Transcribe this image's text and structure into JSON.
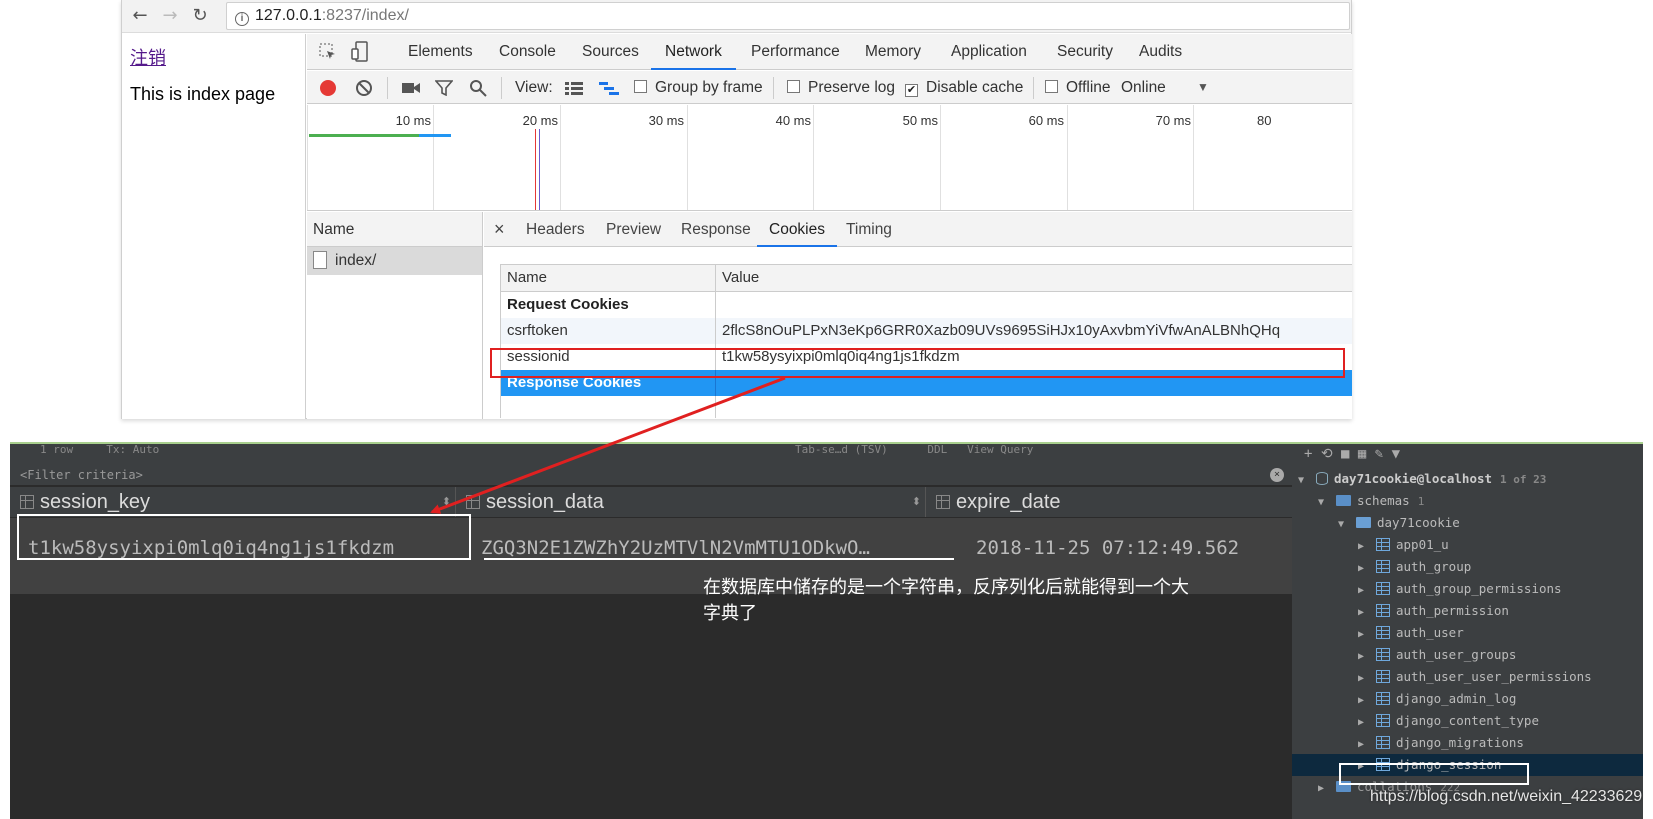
{
  "browser": {
    "url_host": "127.0.0.1",
    "url_rest": ":8237/index/",
    "back_glyph": "←",
    "forward_glyph": "→",
    "reload_glyph": "↻",
    "info_glyph": "i"
  },
  "page": {
    "logout_link": "注销",
    "index_text": "This is index page"
  },
  "devtools": {
    "tabs": [
      "Elements",
      "Console",
      "Sources",
      "Network",
      "Performance",
      "Memory",
      "Application",
      "Security",
      "Audits"
    ],
    "active_tab": "Network",
    "toolbar": {
      "view_label": "View:",
      "group_by_frame": "Group by frame",
      "preserve_log": "Preserve log",
      "disable_cache": "Disable cache",
      "disable_cache_checked": "✔",
      "offline": "Offline",
      "throttle": "Online",
      "throttle_caret": "▼"
    },
    "timeline_ticks": [
      "10 ms",
      "20 ms",
      "30 ms",
      "40 ms",
      "50 ms",
      "60 ms",
      "70 ms",
      "80"
    ],
    "name_header": "Name",
    "request_name": "index/",
    "close_glyph": "×",
    "detail_tabs": [
      "Headers",
      "Preview",
      "Response",
      "Cookies",
      "Timing"
    ],
    "active_detail_tab": "Cookies",
    "cookie_table": {
      "col_name": "Name",
      "col_value": "Value",
      "request_group": "Request Cookies",
      "rows": [
        {
          "name": "csrftoken",
          "value": "2flcS8nOuPLPxN3eKp6GRR0Xazb09UVs9695SiHJx10yAxvbmYiVfwAnALBNhQHq"
        },
        {
          "name": "sessionid",
          "value": "t1kw58ysyixpi0mlq0iq4ng1js1fkdzm"
        }
      ],
      "response_group": "Response Cookies"
    }
  },
  "ide": {
    "toolbar_text": "1 row     Tx: Auto                                                                                                Tab-se…d (TSV)      DDL   View Query",
    "filter_placeholder": "<Filter criteria>",
    "clear_glyph": "×",
    "sort_glyph": "⬍",
    "columns": [
      "session_key",
      "session_data",
      "expire_date"
    ],
    "row": {
      "session_key": "t1kw58ysyixpi0mlq0iq4ng1js1fkdzm",
      "session_data": "ZGQ3N2E1ZWZhY2UzMTVlN2VmMTU1ODkwO…",
      "expire_date": "2018-11-25 07:12:49.562"
    },
    "annotation": "在数据库中储存的是一个字符串，反序列化后就能得到一个大字典了"
  },
  "db_tree": {
    "toolbar": "+  ⟲  ■  ▦  ✎  ▼",
    "arrow_expanded": "▼",
    "arrow_collapsed": "▶",
    "connection": "day71cookie@localhost",
    "connection_count": "1 of 23",
    "schemas": "schemas",
    "schemas_count": "1",
    "database": "day71cookie",
    "tables": [
      "app01_u",
      "auth_group",
      "auth_group_permissions",
      "auth_permission",
      "auth_user",
      "auth_user_groups",
      "auth_user_user_permissions",
      "django_admin_log",
      "django_content_type",
      "django_migrations",
      "django_session"
    ],
    "collations": "collations",
    "collations_count": "222",
    "selected_table": "django_session"
  },
  "watermark": "https://blog.csdn.net/weixin_42233629",
  "colors": {
    "highlight_red": "#e02020",
    "selected_blue": "#2196f3",
    "ide_bg": "#2b2b2b"
  }
}
